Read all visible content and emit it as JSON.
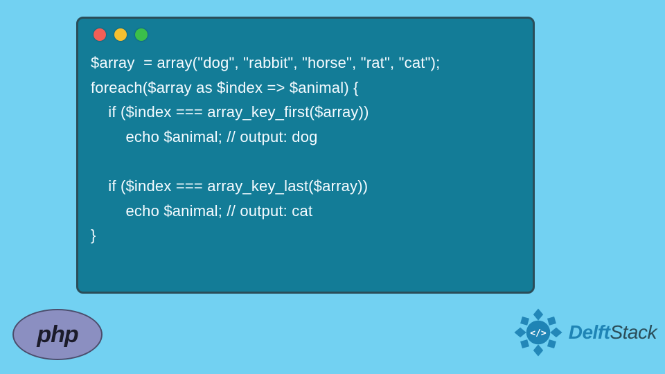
{
  "code": {
    "lines": [
      "$array  = array(\"dog\", \"rabbit\", \"horse\", \"rat\", \"cat\");",
      "foreach($array as $index => $animal) {",
      "    if ($index === array_key_first($array))",
      "        echo $animal; // output: dog",
      "",
      "    if ($index === array_key_last($array))",
      "        echo $animal; // output: cat",
      "}"
    ]
  },
  "logos": {
    "php_label": "php",
    "delft_prefix": "Delft",
    "delft_suffix": "Stack"
  },
  "colors": {
    "bg": "#72d1f2",
    "card": "#137c97",
    "card_border": "#2a4d59",
    "code_text": "#f5fbff"
  }
}
